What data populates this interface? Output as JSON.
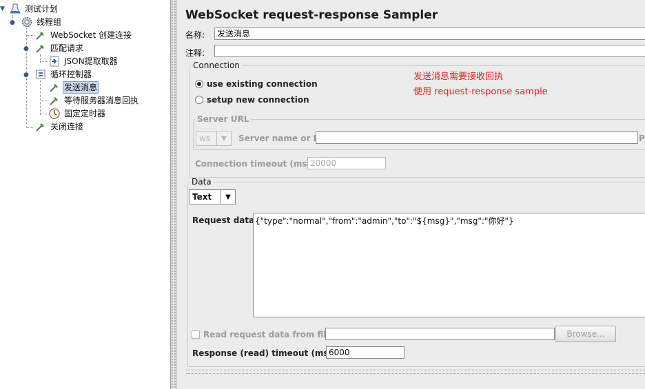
{
  "tree": {
    "items": [
      {
        "label": "测试计划",
        "icon": "test-plan-icon"
      },
      {
        "label": "线程组",
        "icon": "gear-icon"
      },
      {
        "label": "WebSocket 创建连接",
        "icon": "pipette-icon"
      },
      {
        "label": "匹配请求",
        "icon": "pipette-icon"
      },
      {
        "label": "JSON提取取器",
        "icon": "extractor-icon"
      },
      {
        "label": "循环控制器",
        "icon": "loop-controller-icon"
      },
      {
        "label": "发送消息",
        "icon": "pipette-icon"
      },
      {
        "label": "等待服务器消息回执",
        "icon": "pipette-icon"
      },
      {
        "label": "固定定时器",
        "icon": "clock-icon"
      },
      {
        "label": "关闭连接",
        "icon": "pipette-icon"
      }
    ]
  },
  "panel": {
    "title": "WebSocket request-response Sampler",
    "name_label": "名称:",
    "name_value": "发送消息",
    "comment_label": "注释:",
    "comment_value": "",
    "connection": {
      "legend": "Connection",
      "use_existing": "use existing connection",
      "setup_new": "setup new connection",
      "selected": "use_existing",
      "note_line1": "发送消息需要接收回执",
      "note_line2": "使用 request-response sample",
      "server_url_legend": "Server URL",
      "protocol_value": "ws",
      "server_label": "Server name or IP:",
      "server_value": "",
      "port_label_fragment": "Po",
      "timeout_label": "Connection timeout (ms):",
      "timeout_value": "20000"
    },
    "data": {
      "legend": "Data",
      "type_value": "Text",
      "request_label": "Request data:",
      "request_value": "{\"type\":\"normal\",\"from\":\"admin\",\"to\":\"${msg}\",\"msg\":\"你好\"}",
      "read_file_label": "Read request data from file:",
      "read_file_checked": false,
      "file_value": "",
      "browse_label": "Browse...",
      "response_timeout_label": "Response (read) timeout (ms):",
      "response_timeout_value": "6000"
    }
  }
}
